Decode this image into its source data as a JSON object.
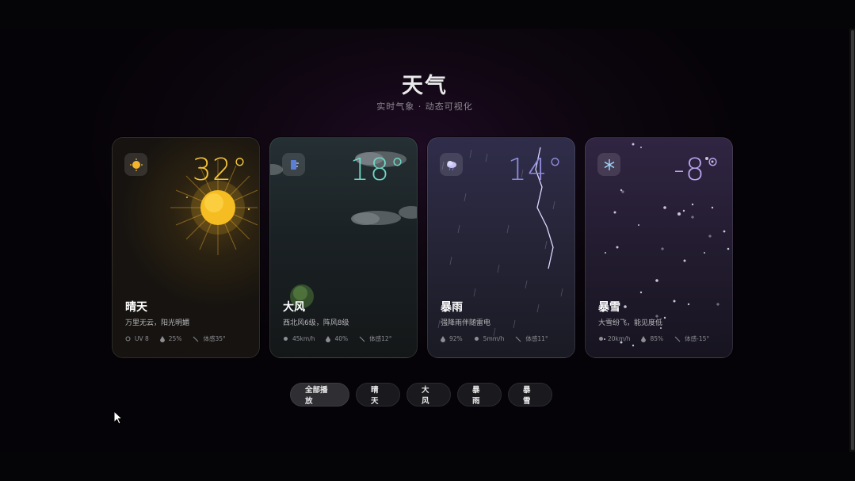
{
  "header": {
    "title": "天气",
    "subtitle": "实时气象 · 动态可视化"
  },
  "cards": [
    {
      "name": "晴天",
      "temp": "32°",
      "desc": "万里无云，阳光明媚",
      "icon": "sun-icon",
      "temp_color": "#f3c53a",
      "stats": [
        "UV 8",
        "25%",
        "体感35°"
      ]
    },
    {
      "name": "大风",
      "temp": "18°",
      "desc": "西北风6级，阵风8级",
      "icon": "wind-icon",
      "temp_color": "#6fd6c3",
      "stats": [
        "45km/h",
        "40%",
        "体感12°"
      ]
    },
    {
      "name": "暴雨",
      "temp": "14°",
      "desc": "强降雨伴随雷电",
      "icon": "storm-cloud-icon",
      "temp_color": "#8f89d8",
      "stats": [
        "92%",
        "5mm/h",
        "体感11°"
      ]
    },
    {
      "name": "暴雪",
      "temp": "-8°",
      "desc": "大雪纷飞，能见度低",
      "icon": "snowflake-icon",
      "temp_color": "#b9a6ee",
      "stats": [
        "20km/h",
        "85%",
        "体感-15°"
      ]
    }
  ],
  "controls": {
    "buttons": [
      "全部播放",
      "晴天",
      "大风",
      "暴雨",
      "暴雪"
    ],
    "active": "全部播放"
  }
}
